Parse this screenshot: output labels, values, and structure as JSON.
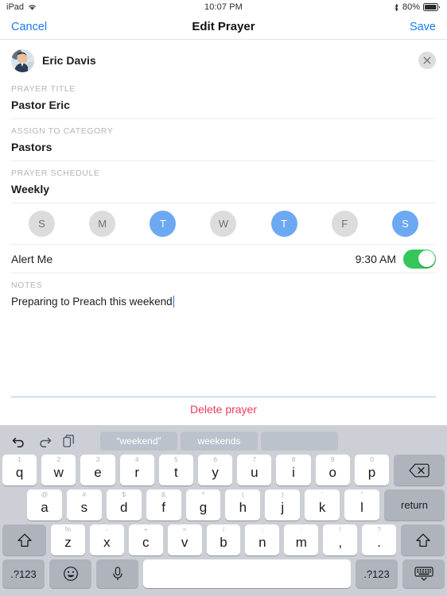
{
  "status_bar": {
    "device": "iPad",
    "wifi_icon": "wifi-icon",
    "time": "10:07 PM",
    "bluetooth_icon": "bluetooth-icon",
    "battery_percent": "80%",
    "battery_icon": "battery-icon"
  },
  "nav_bar": {
    "cancel_label": "Cancel",
    "title": "Edit Prayer",
    "save_label": "Save"
  },
  "person": {
    "name": "Eric Davis",
    "avatar_icon": "avatar-photo",
    "close_icon": "close-icon"
  },
  "fields": [
    {
      "label": "PRAYER TITLE",
      "value": "Pastor Eric"
    },
    {
      "label": "ASSIGN TO CATEGORY",
      "value": "Pastors"
    },
    {
      "label": "PRAYER SCHEDULE",
      "value": "Weekly"
    }
  ],
  "schedule": {
    "days": [
      {
        "letter": "S",
        "day": "sunday",
        "selected": false
      },
      {
        "letter": "M",
        "day": "monday",
        "selected": false
      },
      {
        "letter": "T",
        "day": "tuesday",
        "selected": true
      },
      {
        "letter": "W",
        "day": "wednesday",
        "selected": false
      },
      {
        "letter": "T",
        "day": "thursday",
        "selected": true
      },
      {
        "letter": "F",
        "day": "friday",
        "selected": false
      },
      {
        "letter": "S",
        "day": "saturday",
        "selected": true
      }
    ]
  },
  "alert": {
    "label": "Alert Me",
    "time": "9:30 AM",
    "enabled": true,
    "toggle_color": "#34c85a"
  },
  "notes": {
    "label": "NOTES",
    "value": "Preparing to Preach this weekend"
  },
  "delete": {
    "label": "Delete prayer",
    "color": "#ec3b5c"
  },
  "keyboard": {
    "toolbar": {
      "undo_icon": "undo-icon",
      "redo_icon": "redo-icon",
      "paste_icon": "paste-icon",
      "suggestions": [
        "“weekend”",
        "weekends",
        ""
      ]
    },
    "row1": [
      {
        "main": "q",
        "alt": "1"
      },
      {
        "main": "w",
        "alt": "2"
      },
      {
        "main": "e",
        "alt": "3"
      },
      {
        "main": "r",
        "alt": "4"
      },
      {
        "main": "t",
        "alt": "5"
      },
      {
        "main": "y",
        "alt": "6"
      },
      {
        "main": "u",
        "alt": "7"
      },
      {
        "main": "i",
        "alt": "8"
      },
      {
        "main": "o",
        "alt": "9"
      },
      {
        "main": "p",
        "alt": "0"
      }
    ],
    "backspace_icon": "backspace-icon",
    "row2": [
      {
        "main": "a",
        "alt": "@"
      },
      {
        "main": "s",
        "alt": "#"
      },
      {
        "main": "d",
        "alt": "$"
      },
      {
        "main": "f",
        "alt": "&"
      },
      {
        "main": "g",
        "alt": "*"
      },
      {
        "main": "h",
        "alt": "("
      },
      {
        "main": "j",
        "alt": ")"
      },
      {
        "main": "k",
        "alt": "’"
      },
      {
        "main": "l",
        "alt": "”"
      }
    ],
    "return_label": "return",
    "row3": [
      {
        "main": "z",
        "alt": "%"
      },
      {
        "main": "x",
        "alt": "-"
      },
      {
        "main": "c",
        "alt": "+"
      },
      {
        "main": "v",
        "alt": "="
      },
      {
        "main": "b",
        "alt": "/"
      },
      {
        "main": "n",
        "alt": ";"
      },
      {
        "main": "m",
        "alt": ":"
      },
      {
        "main": ",",
        "alt": "!"
      },
      {
        "main": ".",
        "alt": "?"
      }
    ],
    "shift_icon": "shift-icon",
    "bottom": {
      "numeric_left_label": ".?123",
      "emoji_icon": "emoji-icon",
      "mic_icon": "microphone-icon",
      "space_label": "",
      "numeric_right_label": ".?123",
      "hide_keyboard_icon": "hide-keyboard-icon"
    }
  }
}
